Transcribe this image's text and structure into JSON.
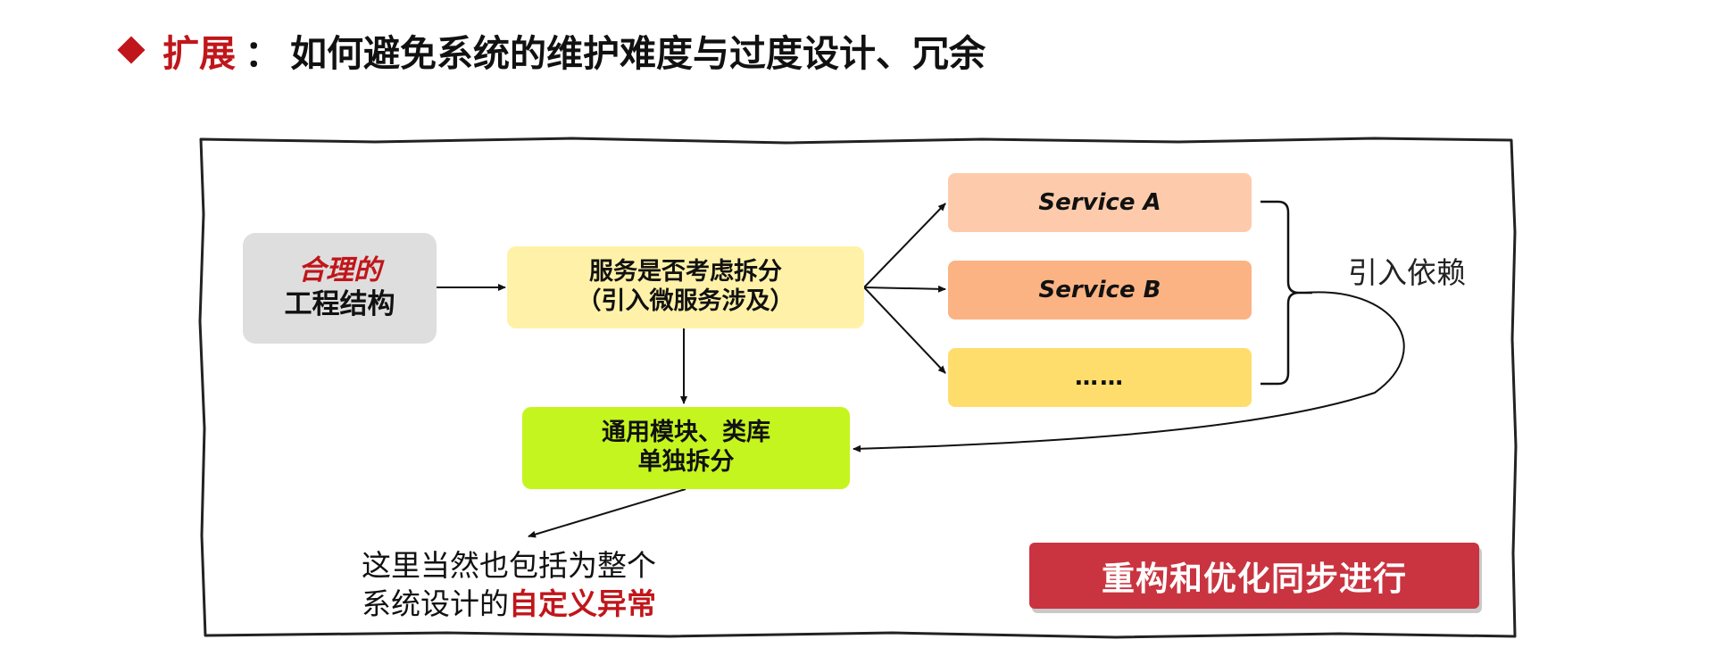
{
  "title": {
    "accent": "扩展",
    "separator": "：",
    "text": "如何避免系统的维护难度与过度设计、冗余"
  },
  "diagram": {
    "structure": {
      "line1": "合理的",
      "line2": "工程结构"
    },
    "split": {
      "line1": "服务是否考虑拆分",
      "line2": "（引入微服务涉及）"
    },
    "common": {
      "line1": "通用模块、类库",
      "line2": "单独拆分"
    },
    "services": [
      "Service A",
      "Service B",
      "……"
    ],
    "dependency_label": "引入依赖",
    "note": {
      "line1": "这里当然也包括为整个",
      "line2_plain": "系统设计的",
      "line2_highlight": "自定义异常"
    },
    "button": "重构和优化同步进行"
  },
  "colors": {
    "accent_red": "#c0161b",
    "button_red": "#c93440",
    "structure_gray": "#dedede",
    "split_yellow": "#fff2a8",
    "common_green": "#c5f51e",
    "service_a": "#fdcbab",
    "service_b": "#fbb384",
    "service_more": "#fedd6c"
  }
}
